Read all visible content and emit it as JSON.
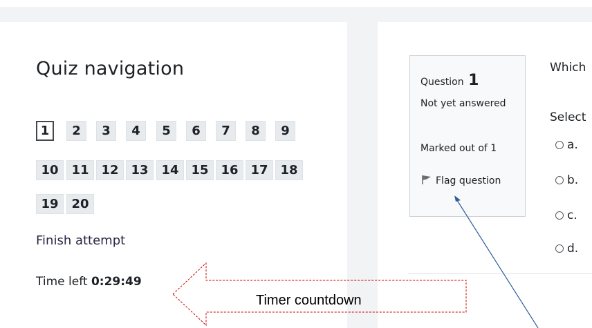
{
  "nav": {
    "title": "Quiz navigation",
    "questions": [
      {
        "label": "1",
        "current": true
      },
      {
        "label": "2",
        "current": false
      },
      {
        "label": "3",
        "current": false
      },
      {
        "label": "4",
        "current": false
      },
      {
        "label": "5",
        "current": false
      },
      {
        "label": "6",
        "current": false
      },
      {
        "label": "7",
        "current": false
      },
      {
        "label": "8",
        "current": false
      },
      {
        "label": "9",
        "current": false
      },
      {
        "label": "10",
        "current": false
      },
      {
        "label": "11",
        "current": false
      },
      {
        "label": "12",
        "current": false
      },
      {
        "label": "13",
        "current": false
      },
      {
        "label": "14",
        "current": false
      },
      {
        "label": "15",
        "current": false
      },
      {
        "label": "16",
        "current": false
      },
      {
        "label": "17",
        "current": false
      },
      {
        "label": "18",
        "current": false
      },
      {
        "label": "19",
        "current": false
      },
      {
        "label": "20",
        "current": false
      }
    ],
    "finish_label": "Finish attempt",
    "time_left_label": "Time left",
    "time_left_value": "0:29:49"
  },
  "question": {
    "label": "Question",
    "number": "1",
    "status": "Not yet answered",
    "marks": "Marked out of 1",
    "flag_label": "Flag question",
    "flag_icon": "flag-icon",
    "text_partial": "Which",
    "select_partial": "Select",
    "options": [
      "a.",
      "b.",
      "c.",
      "d."
    ]
  },
  "annotations": {
    "timer_label": "Timer countdown",
    "arrow_color": "#cc0000",
    "pointer_color": "#2e5c9a"
  }
}
